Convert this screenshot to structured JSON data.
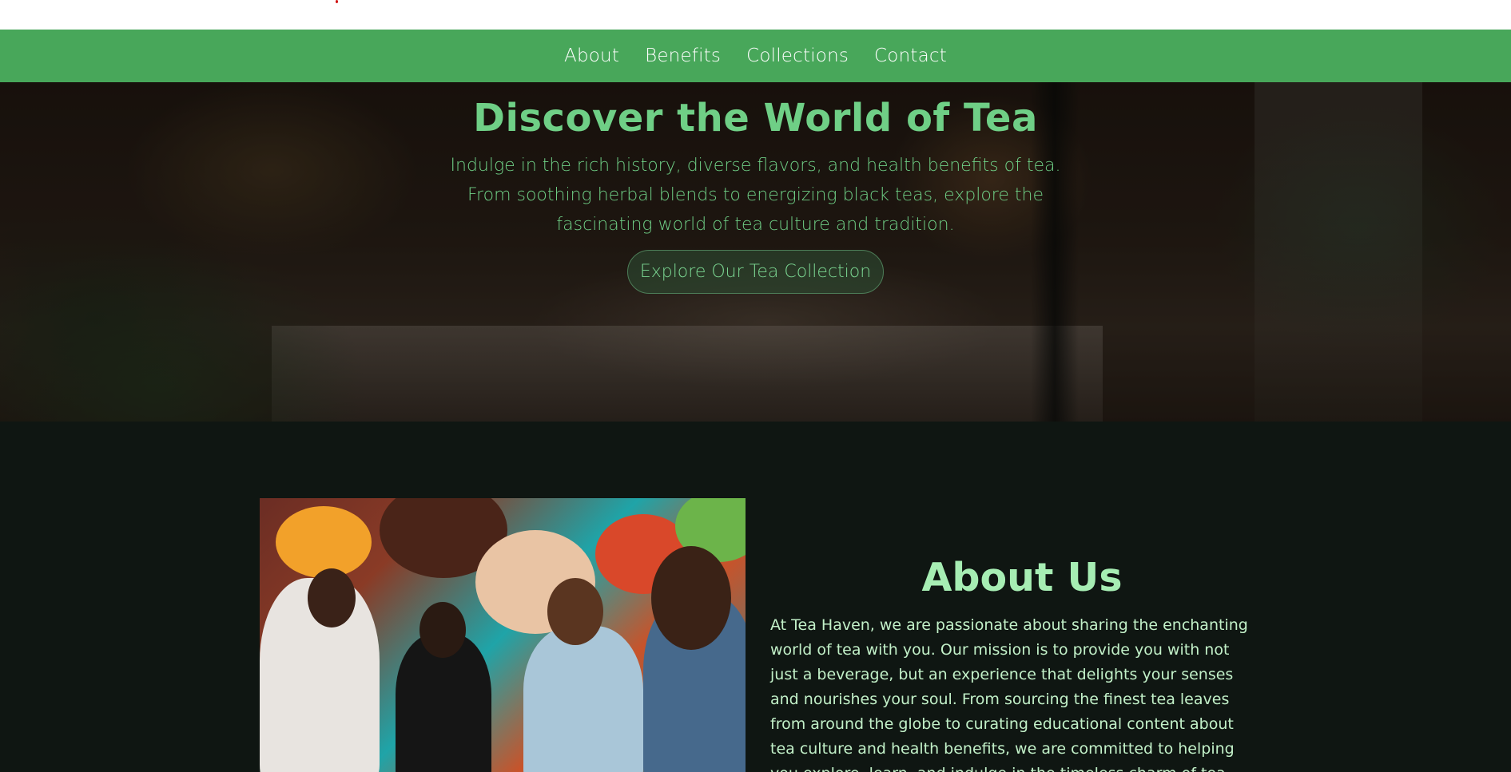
{
  "nav": {
    "items": [
      {
        "label": "About"
      },
      {
        "label": "Benefits"
      },
      {
        "label": "Collections"
      },
      {
        "label": "Contact"
      }
    ]
  },
  "hero": {
    "title": "Discover the World of Tea",
    "subtitle": "Indulge in the rich history, diverse flavors, and health benefits of tea. From soothing herbal blends to energizing black teas, explore the fascinating world of tea culture and tradition.",
    "cta_label": "Explore Our Tea Collection"
  },
  "about": {
    "title": "About Us",
    "body": "At Tea Haven, we are passionate about sharing the enchanting world of tea with you. Our mission is to provide you with not just a beverage, but an experience that delights your senses and nourishes your soul. From sourcing the finest tea leaves from around the globe to curating educational content about tea culture and health benefits, we are committed to helping you explore, learn, and indulge in the timeless charm of tea."
  },
  "colors": {
    "nav_bg": "#48a75a",
    "accent_green": "#6fcf86",
    "page_bg": "#0f1612",
    "about_title": "#a6edb3",
    "about_text": "#c2f0c8"
  }
}
